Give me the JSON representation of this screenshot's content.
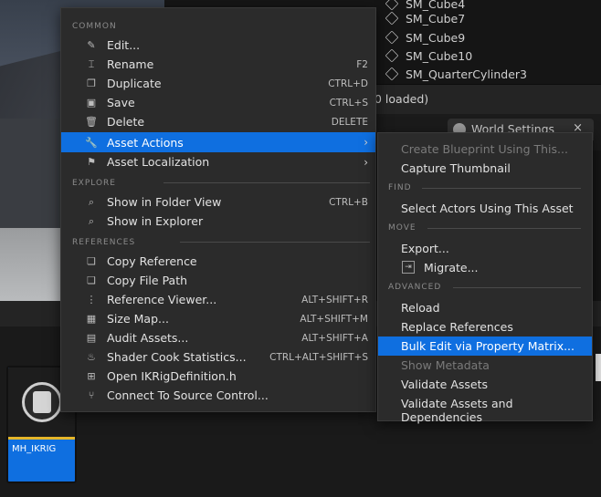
{
  "outliner": {
    "items": [
      "SM_Cube4",
      "SM_Cube7",
      "SM_Cube9",
      "SM_Cube10",
      "SM_QuarterCylinder3"
    ]
  },
  "status": {
    "text": "0 loaded)"
  },
  "world_settings_tab": {
    "label": "World Settings",
    "close": "×"
  },
  "asset": {
    "name": "MH_IKRIG"
  },
  "menu": {
    "sections": {
      "common": "COMMON",
      "explore": "EXPLORE",
      "references": "REFERENCES"
    },
    "items": [
      {
        "label": "Edit...",
        "shortcut": "",
        "icon": "pencil-icon"
      },
      {
        "label": "Rename",
        "shortcut": "F2",
        "icon": "rename-icon"
      },
      {
        "label": "Duplicate",
        "shortcut": "CTRL+D",
        "icon": "duplicate-icon"
      },
      {
        "label": "Save",
        "shortcut": "CTRL+S",
        "icon": "save-icon"
      },
      {
        "label": "Delete",
        "shortcut": "DELETE",
        "icon": "trash-icon"
      },
      {
        "label": "Asset Actions",
        "shortcut": "",
        "icon": "wrench-icon"
      },
      {
        "label": "Asset Localization",
        "shortcut": "",
        "icon": "flag-icon"
      },
      {
        "label": "Show in Folder View",
        "shortcut": "CTRL+B",
        "icon": "folder-search-icon"
      },
      {
        "label": "Show in Explorer",
        "shortcut": "",
        "icon": "explorer-icon"
      },
      {
        "label": "Copy Reference",
        "shortcut": "",
        "icon": "copy-icon"
      },
      {
        "label": "Copy File Path",
        "shortcut": "",
        "icon": "copy-path-icon"
      },
      {
        "label": "Reference Viewer...",
        "shortcut": "ALT+SHIFT+R",
        "icon": "graph-icon"
      },
      {
        "label": "Size Map...",
        "shortcut": "ALT+SHIFT+M",
        "icon": "grid-icon"
      },
      {
        "label": "Audit Assets...",
        "shortcut": "ALT+SHIFT+A",
        "icon": "audit-icon"
      },
      {
        "label": "Shader Cook Statistics...",
        "shortcut": "CTRL+ALT+SHIFT+S",
        "icon": "cook-icon"
      },
      {
        "label": "Open IKRigDefinition.h",
        "shortcut": "",
        "icon": "code-file-icon"
      },
      {
        "label": "Connect To Source Control...",
        "shortcut": "",
        "icon": "source-control-icon"
      }
    ]
  },
  "submenu": {
    "sections": {
      "find": "FIND",
      "move": "MOVE",
      "advanced": "ADVANCED"
    },
    "items": [
      {
        "label": "Create Blueprint Using This...",
        "disabled": true
      },
      {
        "label": "Capture Thumbnail",
        "disabled": false
      },
      {
        "label": "Select Actors Using This Asset",
        "disabled": false
      },
      {
        "label": "Export...",
        "disabled": false
      },
      {
        "label": "Migrate...",
        "disabled": false
      },
      {
        "label": "Reload",
        "disabled": false
      },
      {
        "label": "Replace References",
        "disabled": false
      },
      {
        "label": "Bulk Edit via Property Matrix...",
        "disabled": false
      },
      {
        "label": "Show Metadata",
        "disabled": true
      },
      {
        "label": "Validate Assets",
        "disabled": false
      },
      {
        "label": "Validate Assets and Dependencies",
        "disabled": false
      }
    ]
  },
  "colors": {
    "highlight": "#0f6fe0",
    "menu_bg": "#2b2b2b",
    "asset_accent": "#e5b62a"
  }
}
